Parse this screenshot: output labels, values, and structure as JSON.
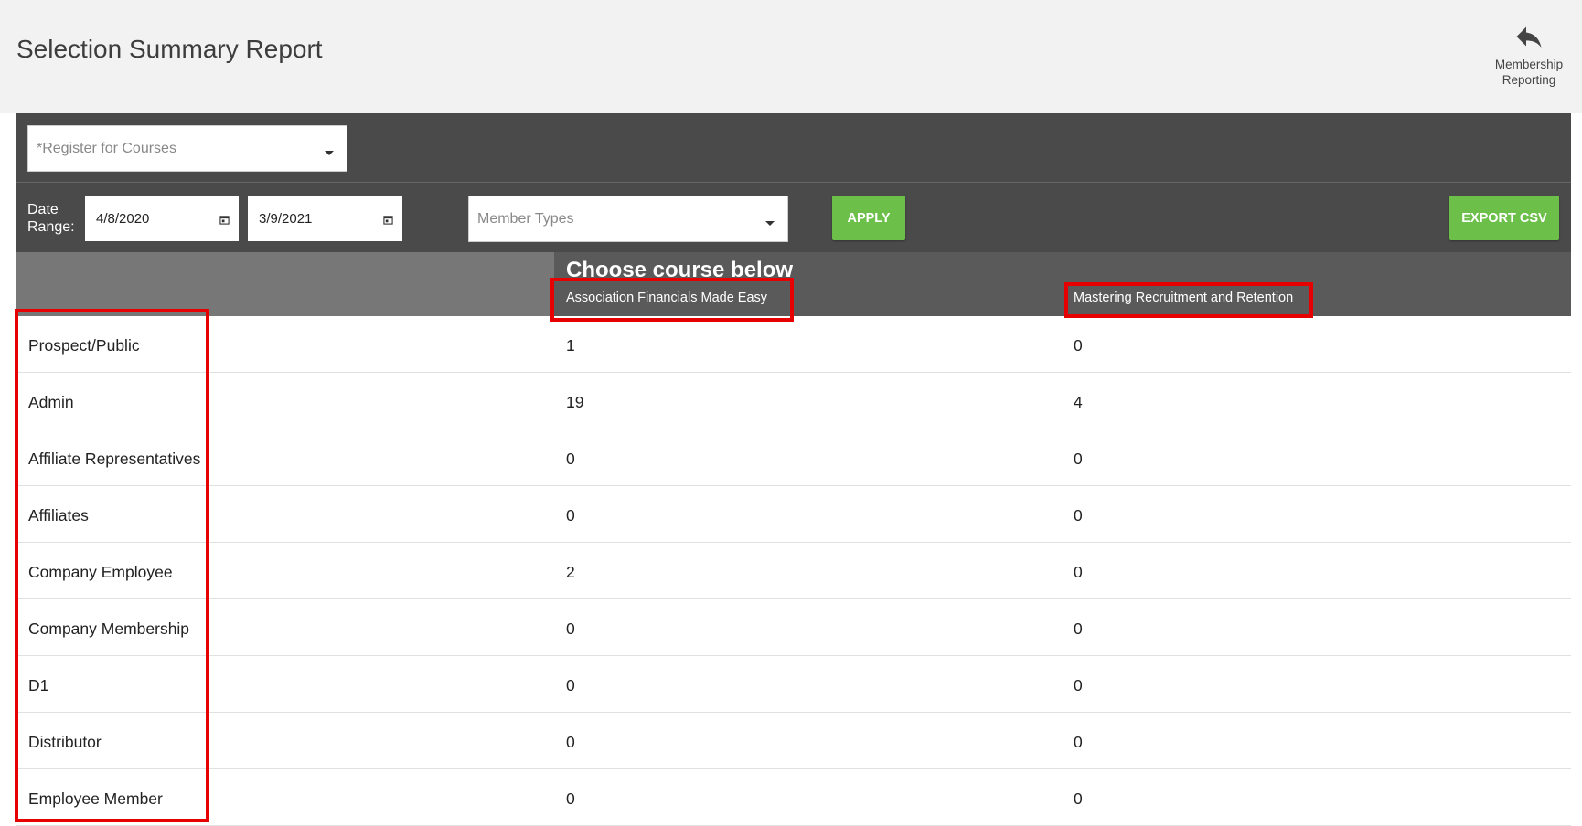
{
  "header": {
    "title": "Selection Summary Report",
    "back_button_label_line1": "Membership",
    "back_button_label_line2": "Reporting",
    "back_icon": "reply-arrow-icon"
  },
  "filters": {
    "course_select_placeholder": "*Register for Courses",
    "date_range_label_line1": "Date",
    "date_range_label_line2": "Range:",
    "start_date": "4/8/2020",
    "end_date": "3/9/2021",
    "member_types_placeholder": "Member Types",
    "apply_label": "APPLY",
    "export_label": "EXPORT CSV"
  },
  "table": {
    "banner": "Choose course below",
    "columns": [
      "Association Financials Made Easy",
      "Mastering Recruitment and Retention"
    ],
    "rows": [
      {
        "label": "Prospect/Public",
        "values": [
          "1",
          "0"
        ]
      },
      {
        "label": "Admin",
        "values": [
          "19",
          "4"
        ]
      },
      {
        "label": "Affiliate Representatives",
        "values": [
          "0",
          "0"
        ]
      },
      {
        "label": "Affiliates",
        "values": [
          "0",
          "0"
        ]
      },
      {
        "label": "Company Employee",
        "values": [
          "2",
          "0"
        ]
      },
      {
        "label": "Company Membership",
        "values": [
          "0",
          "0"
        ]
      },
      {
        "label": "D1",
        "values": [
          "0",
          "0"
        ]
      },
      {
        "label": "Distributor",
        "values": [
          "0",
          "0"
        ]
      },
      {
        "label": "Employee Member",
        "values": [
          "0",
          "0"
        ]
      }
    ]
  },
  "colors": {
    "panel_bg": "#4a4a4a",
    "accent_green": "#6cc04a",
    "highlight_red": "#e60000"
  }
}
